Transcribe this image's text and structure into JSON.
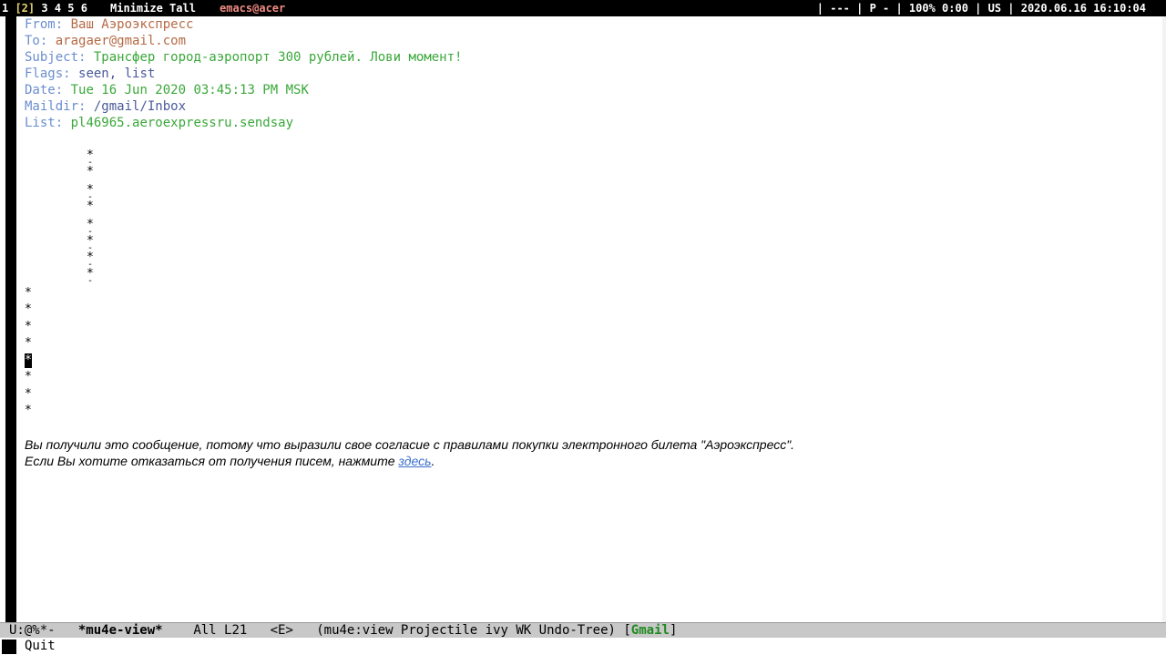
{
  "topbar": {
    "ws_first": "1 ",
    "ws_current": "[2]",
    "ws_rest": " 3 4 5 6",
    "layout": "Minimize Tall",
    "window_title": "emacs@acer",
    "status": "| --- | P - | 100% 0:00 | US | 2020.06.16 16:10:04"
  },
  "headers": {
    "from_key": "From:",
    "from_val": "Ваш Аэроэкспресс",
    "to_key": "To:",
    "to_val": "aragaer@gmail.com",
    "subject_key": "Subject:",
    "subject_val": "Трансфер город-аэропорт 300 рублей. Лови момент!",
    "flags_key": "Flags:",
    "flags_val": "seen, list",
    "date_key": "Date:",
    "date_val": "Tue 16 Jun 2020 03:45:13 PM MSK",
    "maildir_key": "Maildir:",
    "maildir_val": "/gmail/Inbox",
    "list_key": "List:",
    "list_val": "pl46965.aeroexpressru.sendsay"
  },
  "glyphs": {
    "star": "*",
    "dash": "-"
  },
  "body": {
    "line1": "Вы получили это сообщение, потому что выразили свое согласие с правилами покупки электронного билета \"Аэроэкспресс\".",
    "line2_prefix": "Если Вы хотите отказаться от получения писем, нажмите ",
    "line2_link": "здесь",
    "line2_suffix": "."
  },
  "modeline": {
    "state": "U:@%*-",
    "buffer": "*mu4e-view*",
    "position": "All L21",
    "evil": "<E>",
    "modes_prefix": "(mu4e:view Projectile ivy WK Undo-Tree) [",
    "context": "Gmail",
    "modes_suffix": "]"
  },
  "echo": {
    "message": "Quit"
  }
}
